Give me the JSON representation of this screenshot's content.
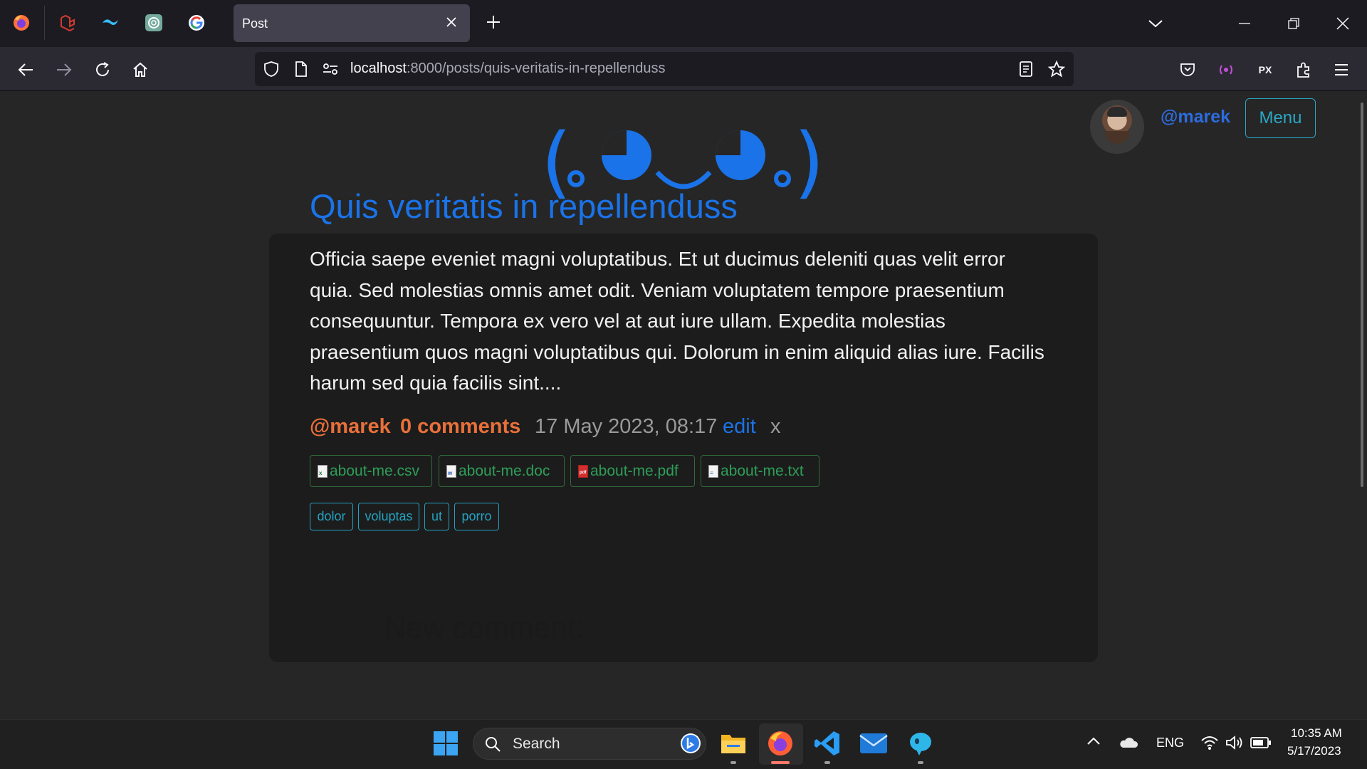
{
  "browser": {
    "tab_title": "Post",
    "url_host": "localhost",
    "url_rest": ":8000/posts/quis-veritatis-in-repellenduss",
    "pinned_tabs": [
      "firefox-icon",
      "laravel-icon",
      "tailwind-icon",
      "chatgpt-icon",
      "google-icon"
    ]
  },
  "header": {
    "logo": "(｡◕‿◕｡)",
    "username": "@marek",
    "menu_label": "Menu"
  },
  "post": {
    "title": "Quis veritatis in repellenduss",
    "body": "Officia saepe eveniet magni voluptatibus. Et ut ducimus deleniti quas velit error quia. Sed molestias omnis amet odit. Veniam voluptatem tempore praesentium consequuntur. Tempora ex vero vel at aut iure ullam. Expedita molestias praesentium quos magni voluptatibus qui. Dolorum in enim aliquid alias iure. Facilis harum sed quia facilis sint....",
    "author": "@marek",
    "comments": "0 comments",
    "date": "17 May 2023, 08:17",
    "edit_label": "edit",
    "delete_label": "x",
    "files": [
      {
        "name": "about-me.csv",
        "icon": "csv-file-icon",
        "color": "#1e7a3c",
        "glyph": "x"
      },
      {
        "name": "about-me.doc",
        "icon": "doc-file-icon",
        "color": "#2b5fb8",
        "glyph": "w"
      },
      {
        "name": "about-me.pdf",
        "icon": "pdf-file-icon",
        "color": "#d32f2f",
        "glyph": "pdf"
      },
      {
        "name": "about-me.txt",
        "icon": "txt-file-icon",
        "color": "#4a6fa5",
        "glyph": "≡"
      }
    ],
    "tags": [
      "dolor",
      "voluptas",
      "ut",
      "porro"
    ]
  },
  "comments_section": {
    "heading": "New comment:"
  },
  "taskbar": {
    "search_placeholder": "Search",
    "language": "ENG",
    "time": "10:35 AM",
    "date": "5/17/2023"
  },
  "colors": {
    "link_blue": "#1a73e8",
    "orange": "#e8703a",
    "tag_cyan": "#23a3c2",
    "file_green": "#2e9e58"
  }
}
